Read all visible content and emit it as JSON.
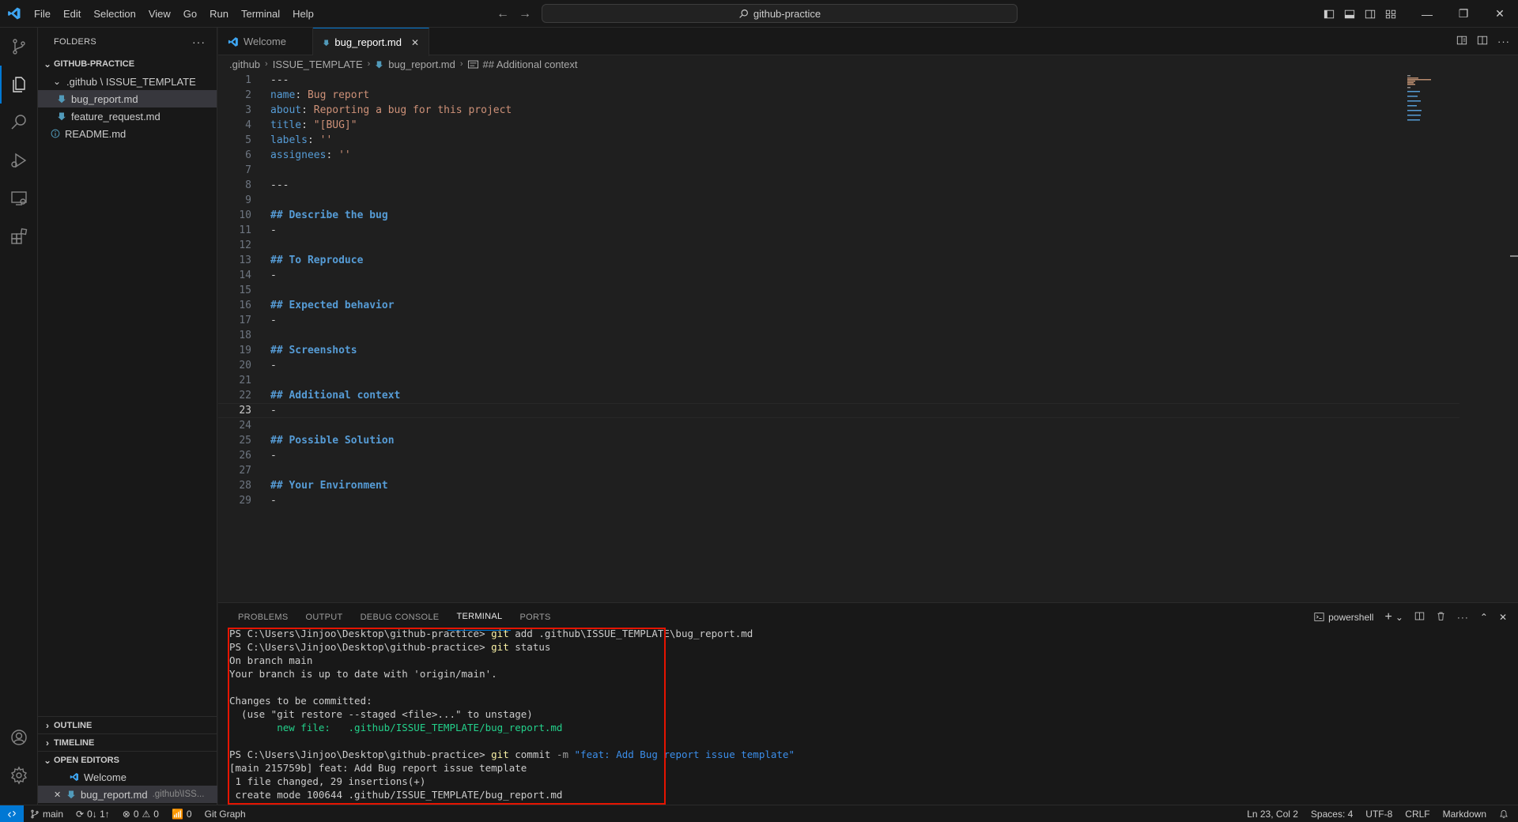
{
  "titlebar": {
    "menu": [
      "File",
      "Edit",
      "Selection",
      "View",
      "Go",
      "Run",
      "Terminal",
      "Help"
    ],
    "search_text": "github-practice"
  },
  "sidebar": {
    "title": "FOLDERS",
    "root": "GITHUB-PRACTICE",
    "folder": ".github \\ ISSUE_TEMPLATE",
    "files": [
      "bug_report.md",
      "feature_request.md"
    ],
    "readme": "README.md",
    "sections": {
      "outline": "OUTLINE",
      "timeline": "TIMELINE",
      "open_editors": "OPEN EDITORS"
    },
    "open_editors": [
      {
        "name": "Welcome",
        "desc": ""
      },
      {
        "name": "bug_report.md",
        "desc": ".github\\ISS..."
      }
    ]
  },
  "editor": {
    "tabs": [
      {
        "label": "Welcome"
      },
      {
        "label": "bug_report.md"
      }
    ],
    "breadcrumbs": [
      ".github",
      "ISSUE_TEMPLATE",
      "bug_report.md",
      "## Additional context"
    ],
    "current_line": 23,
    "lines": [
      {
        "n": "1",
        "parts": [
          {
            "t": "---",
            "c": "p"
          }
        ]
      },
      {
        "n": "2",
        "parts": [
          {
            "t": "name",
            "c": "k"
          },
          {
            "t": ": ",
            "c": "p"
          },
          {
            "t": "Bug report",
            "c": "s"
          }
        ]
      },
      {
        "n": "3",
        "parts": [
          {
            "t": "about",
            "c": "k"
          },
          {
            "t": ": ",
            "c": "p"
          },
          {
            "t": "Reporting a bug for this project",
            "c": "s"
          }
        ]
      },
      {
        "n": "4",
        "parts": [
          {
            "t": "title",
            "c": "k"
          },
          {
            "t": ": ",
            "c": "p"
          },
          {
            "t": "\"[BUG]\"",
            "c": "s"
          }
        ]
      },
      {
        "n": "5",
        "parts": [
          {
            "t": "labels",
            "c": "k"
          },
          {
            "t": ": ",
            "c": "p"
          },
          {
            "t": "''",
            "c": "s"
          }
        ]
      },
      {
        "n": "6",
        "parts": [
          {
            "t": "assignees",
            "c": "k"
          },
          {
            "t": ": ",
            "c": "p"
          },
          {
            "t": "''",
            "c": "s"
          }
        ]
      },
      {
        "n": "7",
        "parts": []
      },
      {
        "n": "8",
        "parts": [
          {
            "t": "---",
            "c": "p"
          }
        ]
      },
      {
        "n": "9",
        "parts": []
      },
      {
        "n": "10",
        "parts": [
          {
            "t": "## Describe the bug",
            "c": "h"
          }
        ]
      },
      {
        "n": "11",
        "parts": [
          {
            "t": "-",
            "c": "dash"
          }
        ]
      },
      {
        "n": "12",
        "parts": []
      },
      {
        "n": "13",
        "parts": [
          {
            "t": "## To Reproduce",
            "c": "h"
          }
        ]
      },
      {
        "n": "14",
        "parts": [
          {
            "t": "-",
            "c": "dash"
          }
        ]
      },
      {
        "n": "15",
        "parts": []
      },
      {
        "n": "16",
        "parts": [
          {
            "t": "## Expected behavior",
            "c": "h"
          }
        ]
      },
      {
        "n": "17",
        "parts": [
          {
            "t": "-",
            "c": "dash"
          }
        ]
      },
      {
        "n": "18",
        "parts": []
      },
      {
        "n": "19",
        "parts": [
          {
            "t": "## Screenshots",
            "c": "h"
          }
        ]
      },
      {
        "n": "20",
        "parts": [
          {
            "t": "-",
            "c": "dash"
          }
        ]
      },
      {
        "n": "21",
        "parts": []
      },
      {
        "n": "22",
        "parts": [
          {
            "t": "## Additional context",
            "c": "h"
          }
        ]
      },
      {
        "n": "23",
        "parts": [
          {
            "t": "-",
            "c": "dash"
          }
        ]
      },
      {
        "n": "24",
        "parts": []
      },
      {
        "n": "25",
        "parts": [
          {
            "t": "## Possible Solution",
            "c": "h"
          }
        ]
      },
      {
        "n": "26",
        "parts": [
          {
            "t": "-",
            "c": "dash"
          }
        ]
      },
      {
        "n": "27",
        "parts": []
      },
      {
        "n": "28",
        "parts": [
          {
            "t": "## Your Environment",
            "c": "h"
          }
        ]
      },
      {
        "n": "29",
        "parts": [
          {
            "t": "-",
            "c": "dash"
          }
        ]
      }
    ]
  },
  "panel": {
    "tabs": [
      "PROBLEMS",
      "OUTPUT",
      "DEBUG CONSOLE",
      "TERMINAL",
      "PORTS"
    ],
    "active_tab": "TERMINAL",
    "shell": "powershell",
    "terminal_lines": [
      [
        {
          "t": "PS C:\\Users\\Jinjoo\\Desktop\\github-practice> ",
          "c": ""
        },
        {
          "t": "git",
          "c": "t-cmd"
        },
        {
          "t": " add .github\\ISSUE_TEMPLATE\\bug_report.md",
          "c": ""
        }
      ],
      [
        {
          "t": "PS C:\\Users\\Jinjoo\\Desktop\\github-practice> ",
          "c": ""
        },
        {
          "t": "git",
          "c": "t-cmd"
        },
        {
          "t": " status",
          "c": ""
        }
      ],
      [
        {
          "t": "On branch main",
          "c": ""
        }
      ],
      [
        {
          "t": "Your branch is up to date with 'origin/main'.",
          "c": ""
        }
      ],
      [],
      [
        {
          "t": "Changes to be committed:",
          "c": ""
        }
      ],
      [
        {
          "t": "  (use \"git restore --staged <file>...\" to unstage)",
          "c": ""
        }
      ],
      [
        {
          "t": "        new file:   .github/ISSUE_TEMPLATE/bug_report.md",
          "c": "t-green"
        }
      ],
      [],
      [
        {
          "t": "PS C:\\Users\\Jinjoo\\Desktop\\github-practice> ",
          "c": ""
        },
        {
          "t": "git",
          "c": "t-cmd"
        },
        {
          "t": " commit ",
          "c": ""
        },
        {
          "t": "-m",
          "c": "t-flag"
        },
        {
          "t": " \"feat: Add Bug report issue template\"",
          "c": "t-str"
        }
      ],
      [
        {
          "t": "[main 215759b] feat: Add Bug report issue template",
          "c": ""
        }
      ],
      [
        {
          "t": " 1 file changed, 29 insertions(+)",
          "c": ""
        }
      ],
      [
        {
          "t": " create mode 100644 .github/ISSUE_TEMPLATE/bug_report.md",
          "c": ""
        }
      ]
    ]
  },
  "statusbar": {
    "branch": "main",
    "sync": "0↓ 1↑",
    "errors": "0",
    "warnings": "0",
    "ports": "0",
    "git_graph": "Git Graph",
    "position": "Ln 23, Col 2",
    "spaces": "Spaces: 4",
    "encoding": "UTF-8",
    "eol": "CRLF",
    "language": "Markdown"
  },
  "colors": {
    "accent": "#0078d4",
    "highlight_box": "#e51400",
    "markdown_icon": "#519aba"
  }
}
